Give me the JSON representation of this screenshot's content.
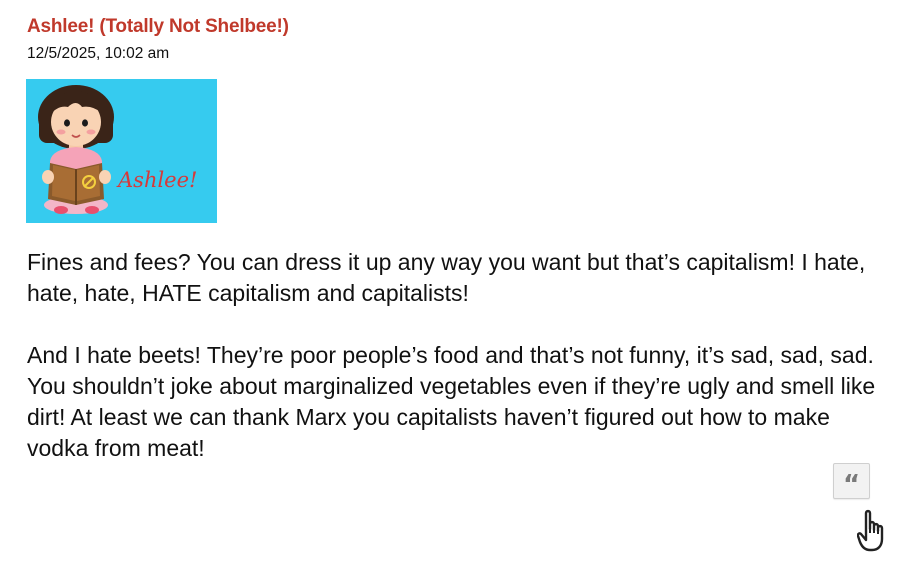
{
  "comment": {
    "author": "Ashlee! (Totally Not Shelbee!)",
    "timestamp": "12/5/2025, 10:02 am",
    "avatar": {
      "signature": "Ashlee!",
      "background_color": "#36cbef"
    },
    "paragraphs": [
      "Fines and fees? You can dress it up any way you want but that’s capitalism! I hate, hate, hate, HATE capitalism and capitalists!",
      "And I hate beets! They’re poor people’s food and that’s not funny, it’s sad, sad, sad. You shouldn’t joke about marginalized vegetables even if they’re ugly and smell like dirt! At least we can thank Marx you capitalists haven’t figured out how to make vodka from meat!"
    ]
  },
  "actions": {
    "quote_icon": "quote-icon",
    "like_icon": "pointing-hand-icon"
  },
  "colors": {
    "author": "#c0392b",
    "text": "#111111",
    "button_bg": "#f2f2f2"
  }
}
